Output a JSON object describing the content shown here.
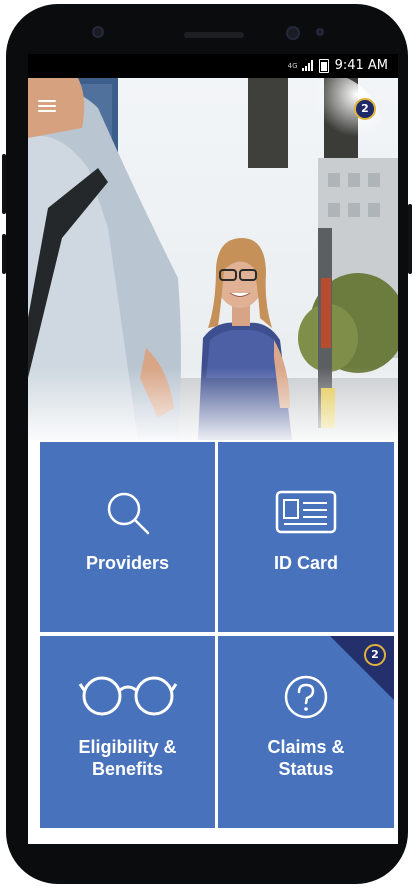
{
  "status_bar": {
    "network": "4G",
    "time": "9:41 AM"
  },
  "header": {
    "notification_count": "2"
  },
  "tiles": [
    {
      "label_line1": "Providers",
      "label_line2": "",
      "icon": "search-icon"
    },
    {
      "label_line1": "ID Card",
      "label_line2": "",
      "icon": "id-card-icon"
    },
    {
      "label_line1": "Eligibility &",
      "label_line2": "Benefits",
      "icon": "glasses-icon"
    },
    {
      "label_line1": "Claims &",
      "label_line2": "Status",
      "icon": "question-icon",
      "badge": "2"
    }
  ],
  "colors": {
    "tile_blue": "#4872bb",
    "badge_navy": "#1f2a6b",
    "badge_ring": "#e0b23a"
  }
}
